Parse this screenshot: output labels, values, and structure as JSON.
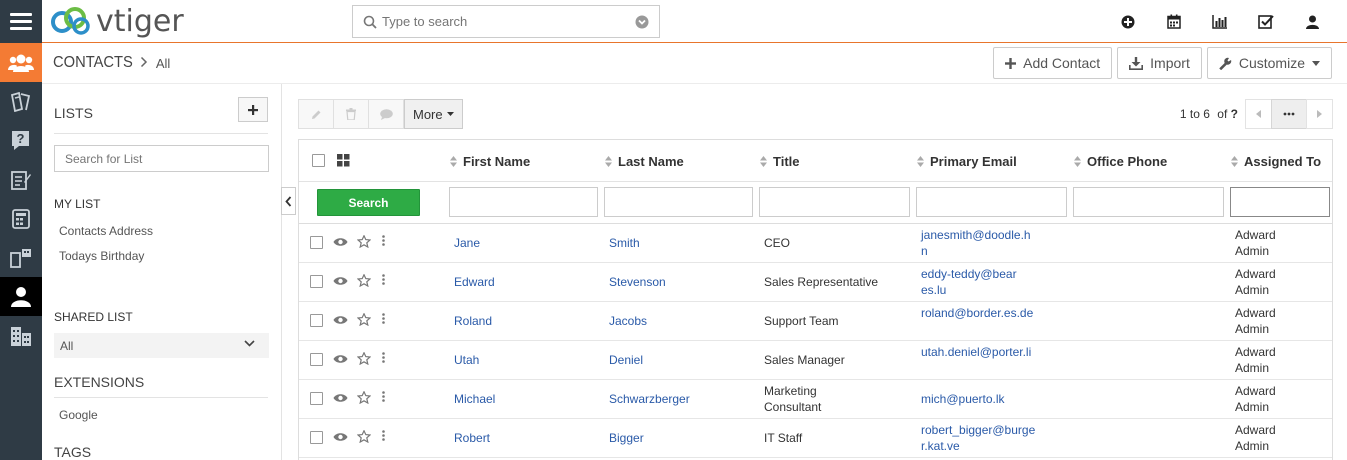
{
  "topbar": {
    "logo_text": "vtiger",
    "search_placeholder": "Type to search",
    "icons": [
      "plus-circle-icon",
      "calendar-icon",
      "bar-chart-icon",
      "checkbox-icon",
      "user-icon"
    ]
  },
  "sidebar_icons": [
    "contacts-icon",
    "marketing-icon",
    "help-icon",
    "inventory-icon",
    "projects-icon",
    "sales-icon",
    "contacts-person-icon",
    "organizations-icon"
  ],
  "header": {
    "module": "CONTACTS",
    "view": "All",
    "add_label": "Add Contact",
    "import_label": "Import",
    "customize_label": "Customize"
  },
  "lists": {
    "title": "LISTS",
    "search_placeholder": "Search for List",
    "my_list_heading": "MY LIST",
    "my_list_items": [
      "Contacts Address",
      "Todays Birthday"
    ],
    "shared_heading": "SHARED LIST",
    "shared_selected": "All",
    "extensions_heading": "EXTENSIONS",
    "extension_items": [
      "Google"
    ],
    "tags_heading": "TAGS"
  },
  "toolbar": {
    "more_label": "More"
  },
  "pager": {
    "range": "1 to 6",
    "of_label": "of",
    "total": "?"
  },
  "table": {
    "columns": [
      "First Name",
      "Last Name",
      "Title",
      "Primary Email",
      "Office Phone",
      "Assigned To"
    ],
    "search_label": "Search",
    "rows": [
      {
        "first": "Jane",
        "last": "Smith",
        "title": "CEO",
        "email": "janesmith@doodle.hn",
        "phone": "",
        "assigned": "Adward Admin"
      },
      {
        "first": "Edward",
        "last": "Stevenson",
        "title": "Sales Representative",
        "email": "eddy-teddy@beares.lu",
        "phone": "",
        "assigned": "Adward Admin"
      },
      {
        "first": "Roland",
        "last": "Jacobs",
        "title": "Support Team",
        "email": "roland@border.es.de",
        "phone": "",
        "assigned": "Adward Admin"
      },
      {
        "first": "Utah",
        "last": "Deniel",
        "title": "Sales Manager",
        "email": "utah.deniel@porter.li",
        "phone": "",
        "assigned": "Adward Admin"
      },
      {
        "first": "Michael",
        "last": "Schwarzberger",
        "title": "Marketing Consultant",
        "email": "mich@puerto.lk",
        "phone": "",
        "assigned": "Adward Admin"
      },
      {
        "first": "Robert",
        "last": "Bigger",
        "title": "IT Staff",
        "email": "robert_bigger@burger.kat.ve",
        "phone": "",
        "assigned": "Adward Admin"
      }
    ]
  },
  "colors": {
    "accent": "#f47b34",
    "sidebar_bg": "#2f3b45",
    "link": "#2a5aa8",
    "search_button": "#2eab45"
  }
}
